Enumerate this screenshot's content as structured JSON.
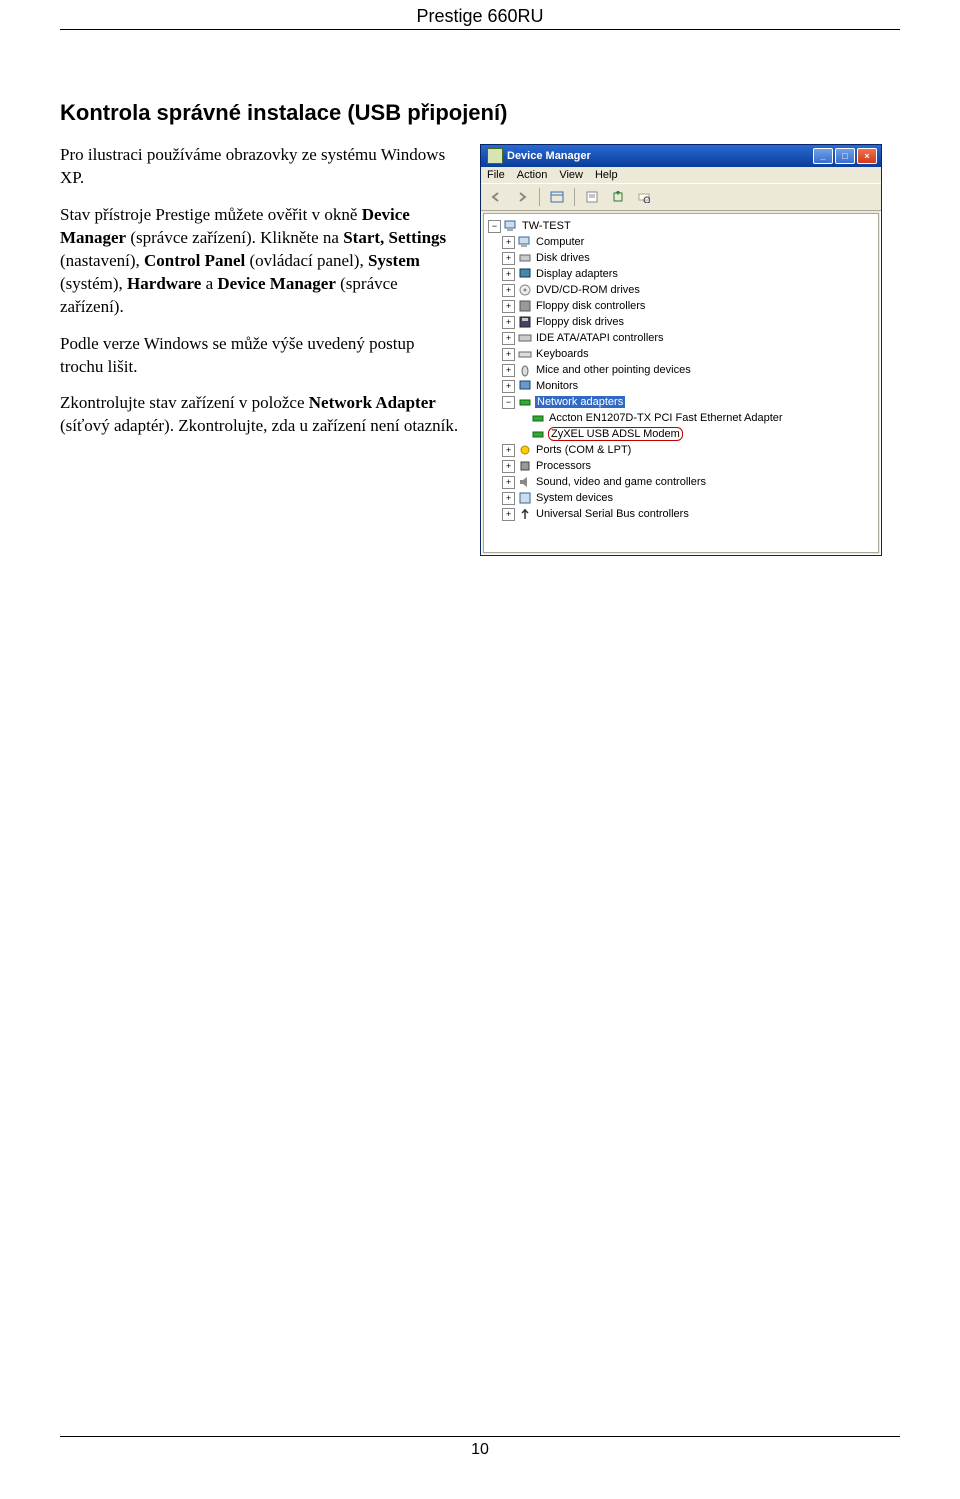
{
  "header": {
    "title": "Prestige 660RU"
  },
  "section": {
    "title": "Kontrola správné instalace (USB připojení)"
  },
  "paragraphs": [
    {
      "html": "Pro ilustraci používáme obrazovky ze systému Windows XP."
    },
    {
      "html": "Stav přístroje Prestige můžete ověřit v okně <b>Device Manager</b> (správce zařízení). Klikněte na <b>Start, Settings</b> (nastavení), <b>Control Panel</b> (ovládací panel), <b>System</b> (systém), <b>Hardware</b> a <b>Device Manager</b> (správce zařízení)."
    },
    {
      "html": "Podle verze Windows se může výše uvedený postup trochu lišit."
    },
    {
      "html": "Zkontrolujte stav zařízení v položce <b>Network Adapter</b> (síťový adaptér). Zkontrolujte, zda u zařízení není otazník."
    }
  ],
  "dm": {
    "title": "Device Manager",
    "menu": [
      "File",
      "Action",
      "View",
      "Help"
    ],
    "root": "TW-TEST",
    "nodes": [
      {
        "exp": "+",
        "icon": "computer",
        "label": "Computer"
      },
      {
        "exp": "+",
        "icon": "disk",
        "label": "Disk drives"
      },
      {
        "exp": "+",
        "icon": "display",
        "label": "Display adapters"
      },
      {
        "exp": "+",
        "icon": "cd",
        "label": "DVD/CD-ROM drives"
      },
      {
        "exp": "+",
        "icon": "floppyctrl",
        "label": "Floppy disk controllers"
      },
      {
        "exp": "+",
        "icon": "floppy",
        "label": "Floppy disk drives"
      },
      {
        "exp": "+",
        "icon": "ide",
        "label": "IDE ATA/ATAPI controllers"
      },
      {
        "exp": "+",
        "icon": "keyboard",
        "label": "Keyboards"
      },
      {
        "exp": "+",
        "icon": "mouse",
        "label": "Mice and other pointing devices"
      },
      {
        "exp": "+",
        "icon": "monitor",
        "label": "Monitors"
      },
      {
        "exp": "-",
        "icon": "network",
        "label": "Network adapters",
        "selected": true,
        "children": [
          {
            "icon": "nic",
            "label": "Accton EN1207D-TX PCI Fast Ethernet Adapter"
          },
          {
            "icon": "nic",
            "label": "ZyXEL USB ADSL Modem",
            "highlighted": true
          }
        ]
      },
      {
        "exp": "+",
        "icon": "ports",
        "label": "Ports (COM & LPT)"
      },
      {
        "exp": "+",
        "icon": "cpu",
        "label": "Processors"
      },
      {
        "exp": "+",
        "icon": "sound",
        "label": "Sound, video and game controllers"
      },
      {
        "exp": "+",
        "icon": "system",
        "label": "System devices"
      },
      {
        "exp": "+",
        "icon": "usb",
        "label": "Universal Serial Bus controllers"
      }
    ]
  },
  "footer": {
    "page": "10"
  }
}
